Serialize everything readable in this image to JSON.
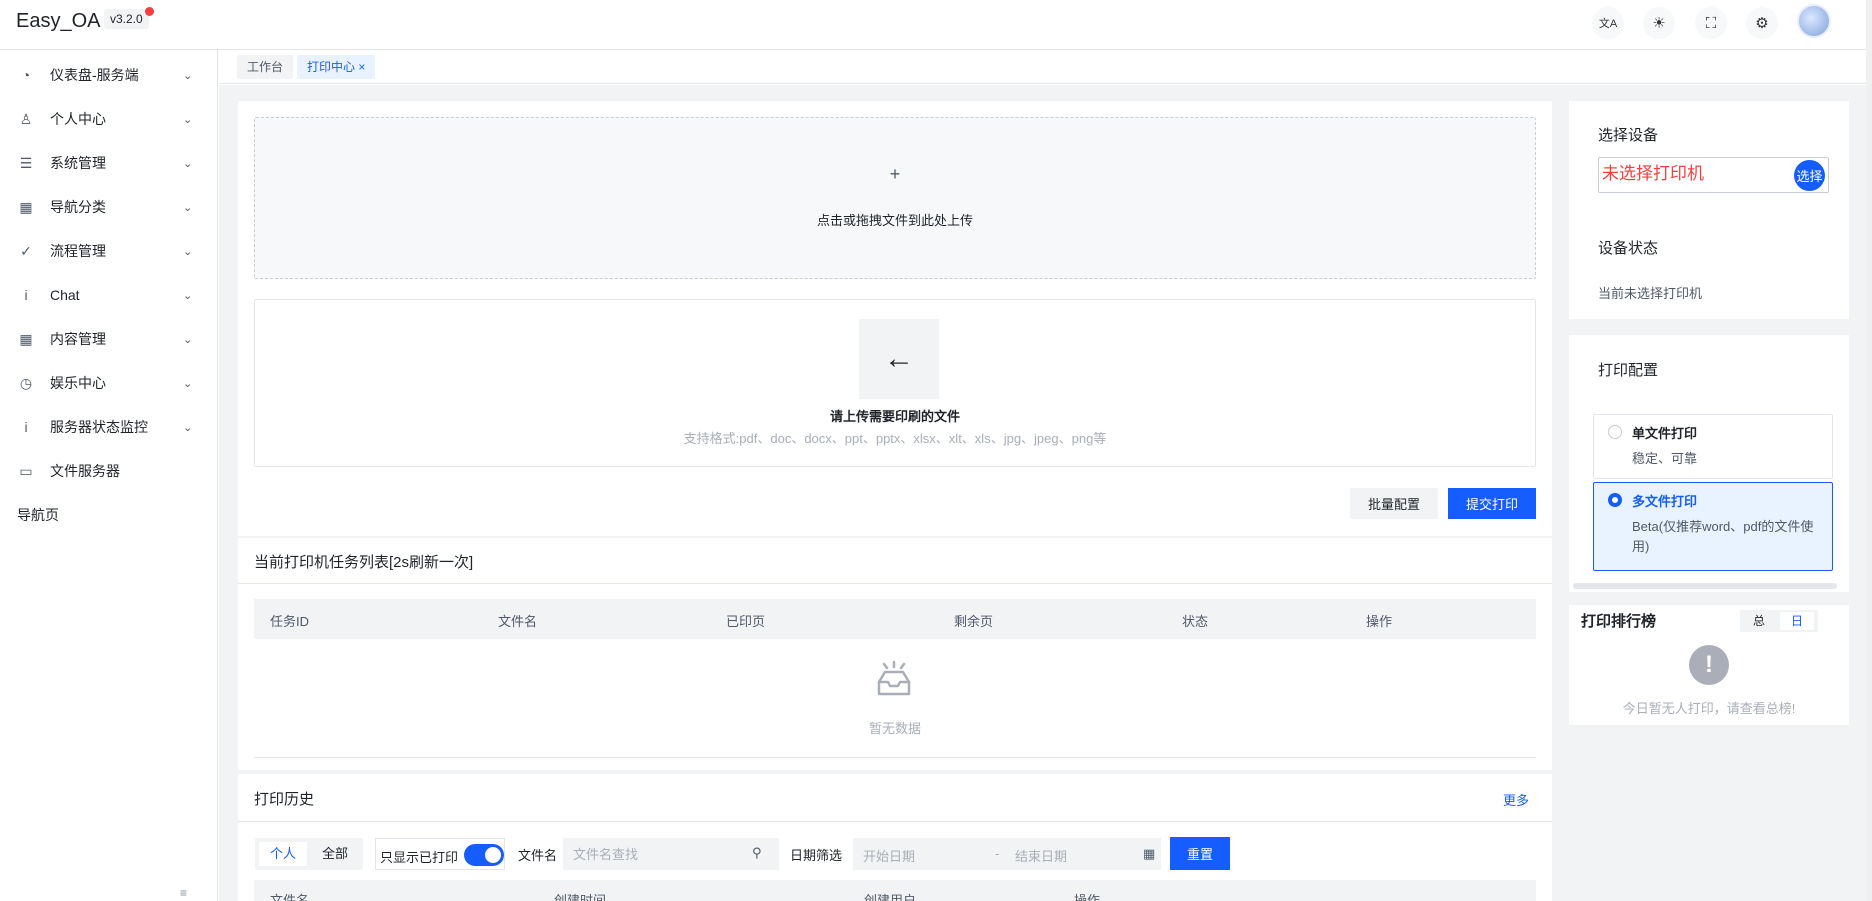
{
  "header": {
    "brand": "Easy_OA",
    "version": "v3.2.0",
    "buttons": [
      {
        "name": "translate-icon",
        "glyph": "文A"
      },
      {
        "name": "theme-icon",
        "glyph": "☀"
      },
      {
        "name": "fullscreen-icon",
        "glyph": "⛶"
      },
      {
        "name": "settings-icon",
        "glyph": "⚙"
      }
    ]
  },
  "sidebar": {
    "items": [
      {
        "label": "仪表盘-服务端",
        "icon": "dashboard-icon",
        "glyph": "◔",
        "expandable": true
      },
      {
        "label": "个人中心",
        "icon": "user-icon",
        "glyph": "♙",
        "expandable": true
      },
      {
        "label": "系统管理",
        "icon": "menu-icon",
        "glyph": "☰",
        "expandable": true
      },
      {
        "label": "导航分类",
        "icon": "grid-icon",
        "glyph": "▦",
        "expandable": true
      },
      {
        "label": "流程管理",
        "icon": "check-circle-icon",
        "glyph": "✓",
        "expandable": true
      },
      {
        "label": "Chat",
        "icon": "info-icon",
        "glyph": "i",
        "expandable": true
      },
      {
        "label": "内容管理",
        "icon": "grid-icon",
        "glyph": "▦",
        "expandable": true
      },
      {
        "label": "娱乐中心",
        "icon": "clock-icon",
        "glyph": "◷",
        "expandable": true
      },
      {
        "label": "服务器状态监控",
        "icon": "info-icon",
        "glyph": "i",
        "expandable": true
      },
      {
        "label": "文件服务器",
        "icon": "folder-icon",
        "glyph": "▭",
        "expandable": false
      }
    ],
    "nav_page": "导航页"
  },
  "tabs": {
    "workbench": "工作台",
    "print_center": "打印中心",
    "close_glyph": "×"
  },
  "upload": {
    "plus": "+",
    "hint": "点击或拖拽文件到此处上传"
  },
  "file_prompt": {
    "arrow": "←",
    "title": "请上传需要印刷的文件",
    "formats": "支持格式:pdf、doc、docx、ppt、pptx、xlsx、xlt、xls、jpg、jpeg、png等"
  },
  "actions": {
    "batch": "批量配置",
    "submit": "提交打印"
  },
  "task_list": {
    "title": "当前打印机任务列表[2s刷新一次]",
    "columns": [
      "任务ID",
      "文件名",
      "已印页",
      "剩余页",
      "状态",
      "操作"
    ],
    "empty": "暂无数据"
  },
  "history": {
    "title": "打印历史",
    "more": "更多",
    "scope_personal": "个人",
    "scope_all": "全部",
    "only_printed": "只显示已打印",
    "only_printed_on": true,
    "filename_label": "文件名",
    "filename_placeholder": "文件名查找",
    "date_label": "日期筛选",
    "date_start": "开始日期",
    "date_sep": "-",
    "date_end": "结束日期",
    "reset": "重置",
    "columns": [
      "文件名",
      "创建时间",
      "创建用户",
      "操作"
    ]
  },
  "device": {
    "title": "选择设备",
    "value": "未选择打印机",
    "select_btn": "选择",
    "status_title": "设备状态",
    "status_text": "当前未选择打印机"
  },
  "print_config": {
    "title": "打印配置",
    "options": [
      {
        "title": "单文件打印",
        "desc": "稳定、可靠",
        "selected": false
      },
      {
        "title": "多文件打印",
        "desc": "Beta(仅推荐word、pdf的文件使用)",
        "selected": true
      }
    ]
  },
  "ranking": {
    "title": "打印排行榜",
    "tab_total": "总",
    "tab_day": "日",
    "active_tab": "日",
    "empty": "今日暂无人打印，请查看总榜!"
  },
  "colors": {
    "primary": "#165dff",
    "danger": "#f53f3f",
    "bg": "#f2f3f5"
  }
}
